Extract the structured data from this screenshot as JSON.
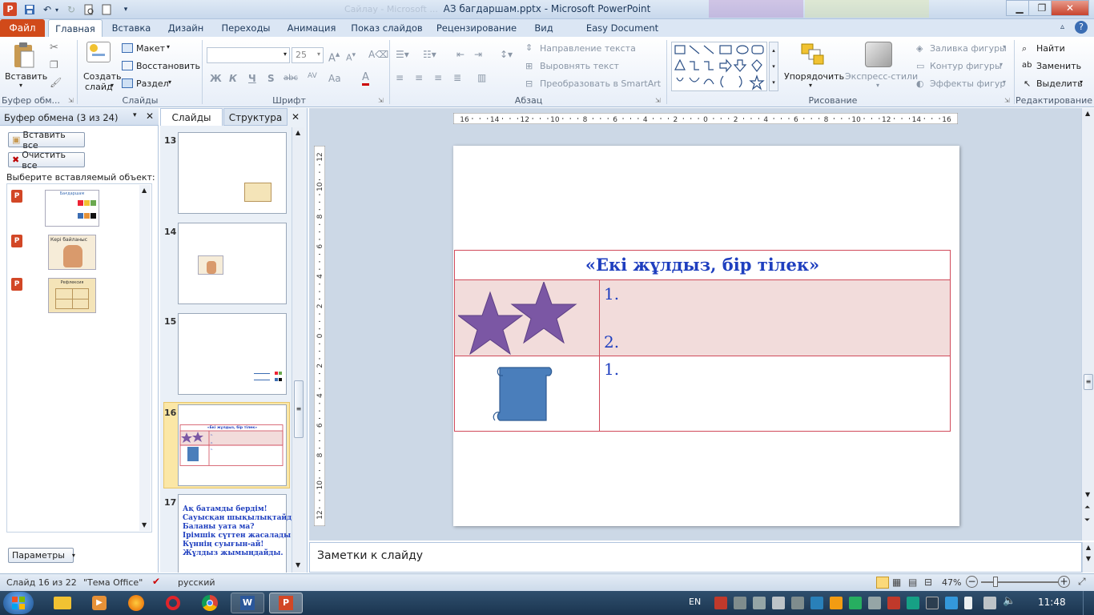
{
  "window": {
    "title": "АЗ багдаршам.pptx - Microsoft PowerPoint",
    "ghost_title": "Сайлау - Microsoft ..."
  },
  "tabs": {
    "file": "Файл",
    "items": [
      "Главная",
      "Вставка",
      "Дизайн",
      "Переходы",
      "Анимация",
      "Показ слайдов",
      "Рецензирование",
      "Вид",
      "Easy Document Creator"
    ]
  },
  "ribbon": {
    "clipboard": {
      "paste": "Вставить",
      "label": "Буфер обм..."
    },
    "slides": {
      "new_slide_1": "Создать",
      "new_slide_2": "слайд",
      "layout": "Макет",
      "reset": "Восстановить",
      "section": "Раздел",
      "label": "Слайды"
    },
    "font": {
      "size": "25",
      "label": "Шрифт",
      "bold": "Ж",
      "italic": "К",
      "underline": "Ч",
      "shadow": "S",
      "strike": "abc",
      "spacing": "AV",
      "case": "Aa"
    },
    "paragraph": {
      "text_dir": "Направление текста",
      "align_text": "Выровнять текст",
      "smartart": "Преобразовать в SmartArt",
      "label": "Абзац"
    },
    "drawing": {
      "arrange": "Упорядочить",
      "quick_styles": "Экспресс-стили",
      "fill": "Заливка фигуры",
      "outline": "Контур фигуры",
      "effects": "Эффекты фигур",
      "label": "Рисование"
    },
    "editing": {
      "find": "Найти",
      "replace": "Заменить",
      "select": "Выделить",
      "label": "Редактирование"
    }
  },
  "clipboard_pane": {
    "title": "Буфер обмена (3 из 24)",
    "paste_all": "Вставить все",
    "clear_all": "Очистить все",
    "prompt": "Выберите вставляемый объект:",
    "params": "Параметры",
    "items": [
      {
        "name": "Бағдаршам"
      },
      {
        "name": "Кері байланыс"
      },
      {
        "name": "Рефлексия"
      }
    ]
  },
  "slides_pane": {
    "tab_slides": "Слайды",
    "tab_outline": "Структура",
    "thumbs": [
      {
        "num": "13"
      },
      {
        "num": "14"
      },
      {
        "num": "15"
      },
      {
        "num": "16"
      },
      {
        "num": "17"
      }
    ],
    "thumb17_lines": [
      "Ақ батамды бердім!",
      "Сауысқан шықылықтайды.",
      "Баланы уата ма?",
      "Ірімшік сүттен жасалады.",
      "Күннің суығын-ай!",
      "Жұлдыз жымыңдайды."
    ],
    "thumb16_title": "«Екі жұлдыз, бір тілек»"
  },
  "ruler": {
    "h_ticks": [
      "16",
      "14",
      "12",
      "10",
      "8",
      "6",
      "4",
      "2",
      "0",
      "2",
      "4",
      "6",
      "8",
      "10",
      "12",
      "14",
      "16"
    ],
    "v_ticks": [
      "12",
      "10",
      "8",
      "6",
      "4",
      "2",
      "0",
      "2",
      "4",
      "6",
      "8",
      "10",
      "12"
    ]
  },
  "slide": {
    "title": "«Екі жұлдыз, бір тілек»",
    "row1": [
      "1.",
      "2."
    ],
    "row2": [
      "1."
    ]
  },
  "notes": {
    "placeholder": "Заметки к слайду"
  },
  "status": {
    "slide": "Слайд 16 из 22",
    "theme": "\"Тема Office\"",
    "lang": "русский",
    "zoom": "47%"
  },
  "taskbar": {
    "lang": "EN",
    "time": "11:48"
  },
  "colors": {
    "accent": "#2b579a",
    "file_tab": "#d14a1a",
    "table_border": "#d04a5a",
    "row_fill": "#f2dcdb",
    "star": "#7b57a4",
    "scroll": "#4a7ebb",
    "title_text": "#1f3fbf"
  }
}
